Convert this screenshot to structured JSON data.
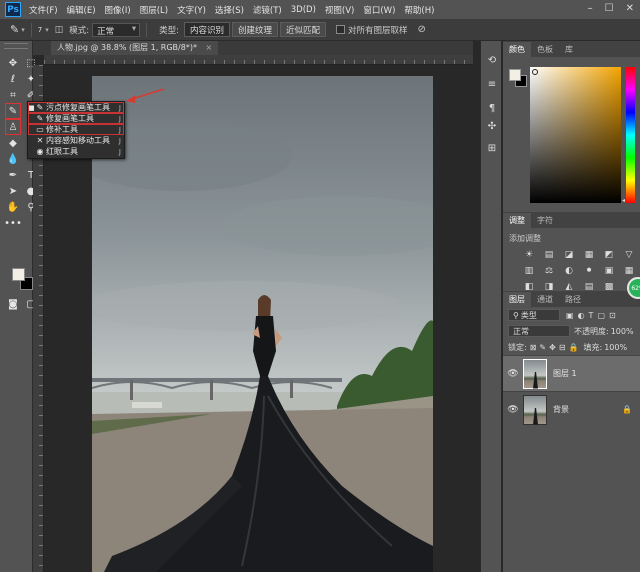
{
  "app": {
    "logo": "Ps",
    "menu": [
      "文件(F)",
      "编辑(E)",
      "图像(I)",
      "图层(L)",
      "文字(Y)",
      "选择(S)",
      "滤镜(T)",
      "3D(D)",
      "视图(V)",
      "窗口(W)",
      "帮助(H)"
    ],
    "window_controls": [
      "–",
      "☐",
      "✕"
    ]
  },
  "options_bar": {
    "brush_size": "7",
    "mode_label": "模式:",
    "mode_value": "正常",
    "type_label": "类型:",
    "type_buttons": [
      "内容识别",
      "创建纹理",
      "近似匹配"
    ],
    "sample_all_layers": "对所有图层取样"
  },
  "document": {
    "tab_title": "人物.jpg @ 38.8% (图层 1, RGB/8*)",
    "tab_modified": "*",
    "close": "×"
  },
  "flyout": {
    "items": [
      {
        "label": "污点修复画笔工具",
        "shortcut": "J",
        "icon": "✎",
        "selected": true
      },
      {
        "label": "修复画笔工具",
        "shortcut": "J",
        "icon": "✎",
        "selected": false
      },
      {
        "label": "修补工具",
        "shortcut": "J",
        "icon": "▭",
        "selected": false
      },
      {
        "label": "内容感知移动工具",
        "shortcut": "J",
        "icon": "✕",
        "selected": false
      },
      {
        "label": "红眼工具",
        "shortcut": "J",
        "icon": "◉",
        "selected": false
      }
    ],
    "annotation_color": "#d83a32"
  },
  "panels": {
    "color_tabs": [
      "颜色",
      "色板",
      "库"
    ],
    "adjust_tabs": [
      "调整",
      "字符"
    ],
    "adjust_title": "添加调整",
    "adjust_icons": [
      "☀",
      "▤",
      "◪",
      "▦",
      "◩",
      "▽",
      "▥",
      "⚖",
      "◐",
      "⚫",
      "▣",
      "▦",
      "◧",
      "◨",
      "◭",
      "▤",
      "▩"
    ],
    "layers_tabs": [
      "图层",
      "通道",
      "路径"
    ],
    "kind_label": "类型",
    "blend_mode": "正常",
    "opacity_label": "不透明度:",
    "opacity_value": "100%",
    "lock_label": "锁定:",
    "fill_label": "填充:",
    "fill_value": "100%",
    "layers": [
      {
        "name": "图层 1",
        "selected": true,
        "locked": false
      },
      {
        "name": "背景",
        "selected": false,
        "locked": true
      }
    ],
    "badge": "62%"
  },
  "colors": {
    "foreground": "#f4efe4",
    "background": "#000000",
    "accent": "#31a8ff"
  }
}
